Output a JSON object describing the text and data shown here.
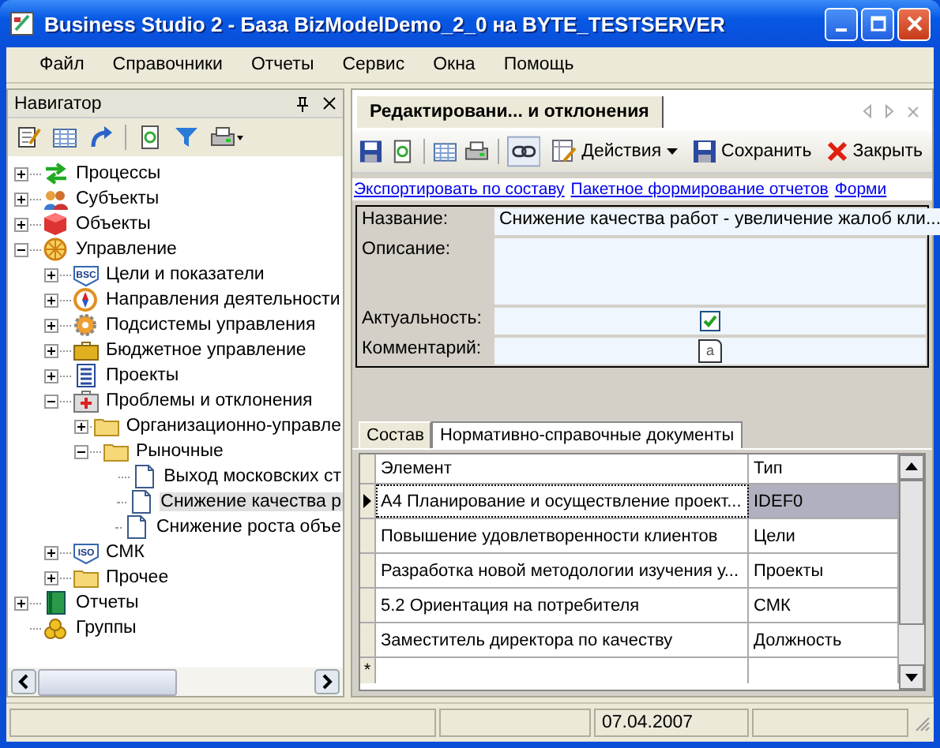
{
  "window": {
    "title": "Business Studio 2 - База BizModelDemo_2_0 на BYTE_TESTSERVER"
  },
  "menu": [
    "Файл",
    "Справочники",
    "Отчеты",
    "Сервис",
    "Окна",
    "Помощь"
  ],
  "navigator": {
    "title": "Навигатор",
    "tree": [
      {
        "label": "Процессы",
        "kind": "arrows",
        "expanded": false,
        "selected": false
      },
      {
        "label": "Субъекты",
        "kind": "people",
        "expanded": false,
        "selected": false
      },
      {
        "label": "Объекты",
        "kind": "cube",
        "expanded": false,
        "selected": false
      },
      {
        "label": "Управление",
        "kind": "wheel",
        "expanded": true,
        "selected": false,
        "children": [
          {
            "label": "Цели и показатели",
            "kind": "badge",
            "badge": "BSC",
            "expanded": false,
            "selected": false
          },
          {
            "label": "Направления деятельности",
            "kind": "compass",
            "expanded": false,
            "selected": false
          },
          {
            "label": "Подсистемы управления",
            "kind": "gear",
            "expanded": false,
            "selected": false
          },
          {
            "label": "Бюджетное управление",
            "kind": "briefcase",
            "expanded": false,
            "selected": false
          },
          {
            "label": "Проекты",
            "kind": "list",
            "expanded": false,
            "selected": false
          },
          {
            "label": "Проблемы и отклонения",
            "kind": "kit",
            "expanded": true,
            "selected": false,
            "children": [
              {
                "label": "Организационно-управле",
                "kind": "folder",
                "expanded": false,
                "selected": false
              },
              {
                "label": "Рыночные",
                "kind": "folder",
                "expanded": true,
                "selected": false,
                "children": [
                  {
                    "label": "Выход московских ст",
                    "kind": "document",
                    "selected": false
                  },
                  {
                    "label": "Снижение качества р",
                    "kind": "document",
                    "selected": true
                  },
                  {
                    "label": "Снижение роста объе",
                    "kind": "document",
                    "selected": false
                  }
                ]
              }
            ]
          },
          {
            "label": "СМК",
            "kind": "badge",
            "badge": "ISO",
            "expanded": false,
            "selected": false
          },
          {
            "label": "Прочее",
            "kind": "folder",
            "expanded": false,
            "selected": false
          }
        ]
      },
      {
        "label": "Отчеты",
        "kind": "book",
        "expanded": false,
        "selected": false
      },
      {
        "label": "Группы",
        "kind": "coins",
        "selected": false
      }
    ]
  },
  "document": {
    "tab": "Редактировани... и отклонения",
    "toolbar": {
      "actions": "Действия",
      "save": "Сохранить",
      "close": "Закрыть"
    },
    "links": [
      "Экспортировать по составу",
      "Пакетное формирование отчетов",
      "Форми"
    ],
    "fields": [
      {
        "label": "Название:",
        "kind": "text",
        "value": "Снижение качества работ - увеличение жалоб кли..."
      },
      {
        "label": "Описание:",
        "kind": "textarea"
      },
      {
        "label": "Актуальность:",
        "kind": "checkbox",
        "checked": true
      },
      {
        "label": "Комментарий:",
        "kind": "note",
        "value": "a"
      }
    ],
    "subtabs": [
      {
        "label": "Состав",
        "selected": true
      },
      {
        "label": "Нормативно-справочные документы",
        "selected": false
      }
    ],
    "table": {
      "columns": [
        "Элемент",
        "Тип"
      ],
      "rows": [
        {
          "cells": [
            "A4 Планирование и осуществление проект...",
            "IDEF0"
          ],
          "selected": true
        },
        {
          "cells": [
            "Повышение удовлетворенности клиентов",
            "Цели"
          ],
          "selected": false
        },
        {
          "cells": [
            "Разработка новой методологии изучения у...",
            "Проекты"
          ],
          "selected": false
        },
        {
          "cells": [
            "5.2 Ориентация на потребителя",
            "СМК"
          ],
          "selected": false
        },
        {
          "cells": [
            "Заместитель директора по качеству",
            "Должность"
          ],
          "selected": false
        }
      ],
      "new_row_marker": "*"
    }
  },
  "status_bar": {
    "date": "07.04.2007"
  }
}
